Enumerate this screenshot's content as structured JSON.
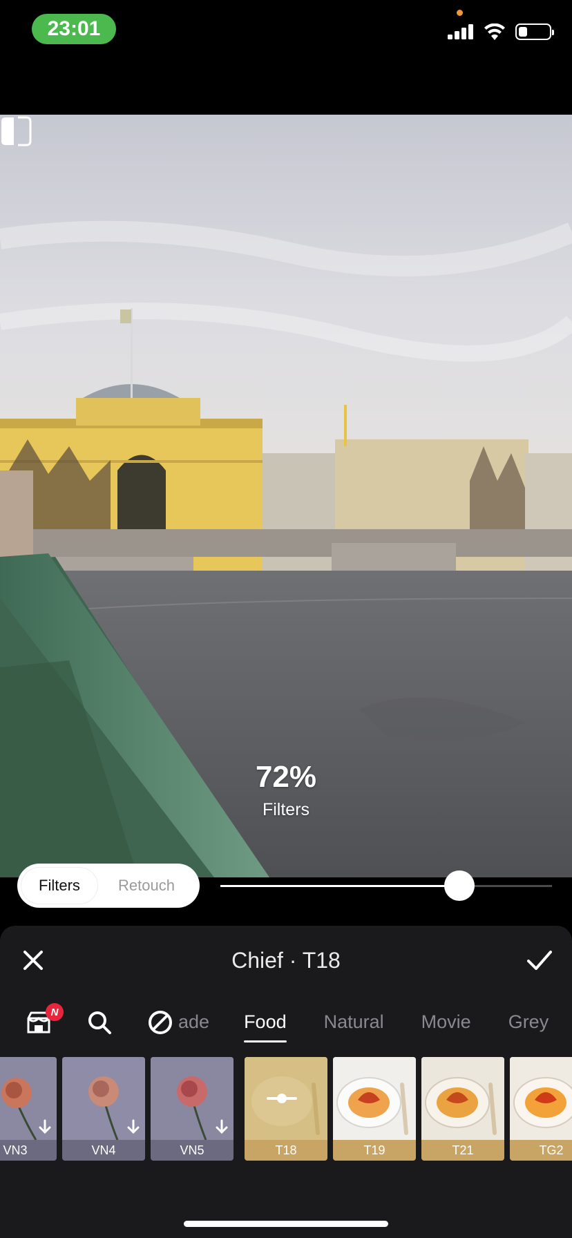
{
  "status_bar": {
    "time": "23:01"
  },
  "photo": {
    "intensity_value": "72%",
    "intensity_label": "Filters"
  },
  "mode_toggle": {
    "active": "Filters",
    "inactive": "Retouch"
  },
  "slider": {
    "value": 0.72
  },
  "panel": {
    "title": "Chief · T18"
  },
  "categories": {
    "badge": "N",
    "tabs": [
      "ade",
      "Food",
      "Natural",
      "Movie",
      "Grey"
    ],
    "active_tab": "Food"
  },
  "thumbnails": [
    {
      "label": "VN3",
      "kind": "vn",
      "downloadable": true
    },
    {
      "label": "VN4",
      "kind": "vn",
      "downloadable": true
    },
    {
      "label": "VN5",
      "kind": "vn",
      "downloadable": true
    },
    {
      "label": "T18",
      "kind": "food",
      "selected": true
    },
    {
      "label": "T19",
      "kind": "food"
    },
    {
      "label": "T21",
      "kind": "food"
    },
    {
      "label": "TG2",
      "kind": "food"
    }
  ],
  "colors": {
    "accent_green": "#4cb94f",
    "badge_red": "#e8253c",
    "food_caption": "#c8a565",
    "vn_caption": "#6b6a80"
  }
}
